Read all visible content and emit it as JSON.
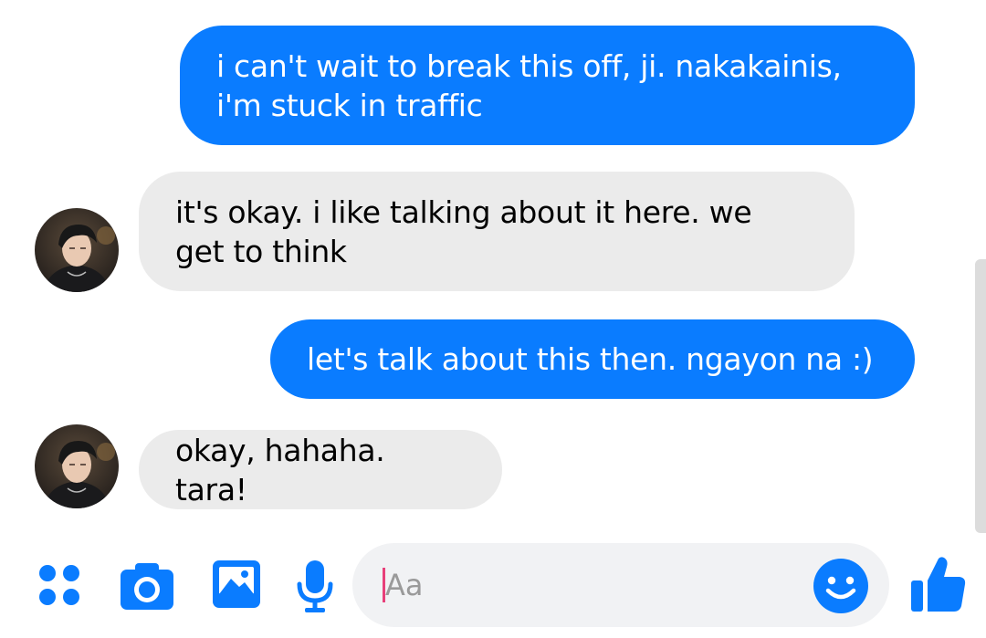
{
  "colors": {
    "accent": "#0a7cff",
    "incoming_bubble": "#ebebeb",
    "caret": "#e8407a"
  },
  "messages": [
    {
      "direction": "outgoing",
      "text": "i can't wait to break this off, ji. nakakainis,\ni'm stuck in traffic"
    },
    {
      "direction": "incoming",
      "text": "it's okay. i like talking about it here. we\nget to think"
    },
    {
      "direction": "outgoing",
      "text": "let's talk about this then. ngayon na :)"
    },
    {
      "direction": "incoming",
      "text": "okay, hahaha. tara!"
    }
  ],
  "composer": {
    "placeholder": "Aa",
    "icons": [
      "apps-icon",
      "camera-icon",
      "gallery-icon",
      "microphone-icon",
      "emoji-icon",
      "thumbs-up-icon"
    ]
  }
}
